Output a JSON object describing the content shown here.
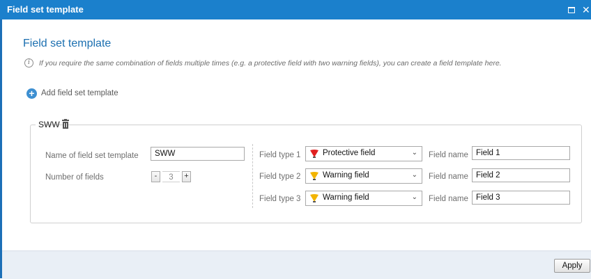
{
  "window": {
    "title": "Field set template",
    "restore_icon": "restore-icon",
    "close_icon": "close-icon",
    "close_glyph": "✕"
  },
  "main": {
    "heading": "Field set template",
    "info_icon": "info-icon",
    "info_glyph": "i",
    "info_text": "If you require the same combination of fields multiple times (e.g. a protective field with two warning fields), you can create a field template here.",
    "add_icon": "plus-circle-icon",
    "add_glyph": "+",
    "add_label": "Add field set template"
  },
  "template": {
    "name": "SWW",
    "delete_icon": "trash-icon",
    "name_label": "Name of field set template",
    "name_value": "SWW",
    "count_label": "Number of fields",
    "decrement_label": "-",
    "count_value": "3",
    "increment_label": "+",
    "fields": [
      {
        "type_label": "Field type 1",
        "type_value": "Protective field",
        "icon": "protective-field-icon",
        "color": "#e02020",
        "name_label": "Field name",
        "name_value": "Field 1"
      },
      {
        "type_label": "Field type 2",
        "type_value": "Warning field",
        "icon": "warning-field-icon",
        "color": "#f2b400",
        "name_label": "Field name",
        "name_value": "Field 2"
      },
      {
        "type_label": "Field type 3",
        "type_value": "Warning field",
        "icon": "warning-field-icon",
        "color": "#f2b400",
        "name_label": "Field name",
        "name_value": "Field 3"
      }
    ],
    "dropdown_icon": "chevron-down-icon",
    "dropdown_glyph": "⌄"
  },
  "footer": {
    "apply_label": "Apply"
  },
  "colors": {
    "titlebar": "#1b80cc",
    "heading": "#1b6fb0",
    "footer": "#e9eff6"
  }
}
